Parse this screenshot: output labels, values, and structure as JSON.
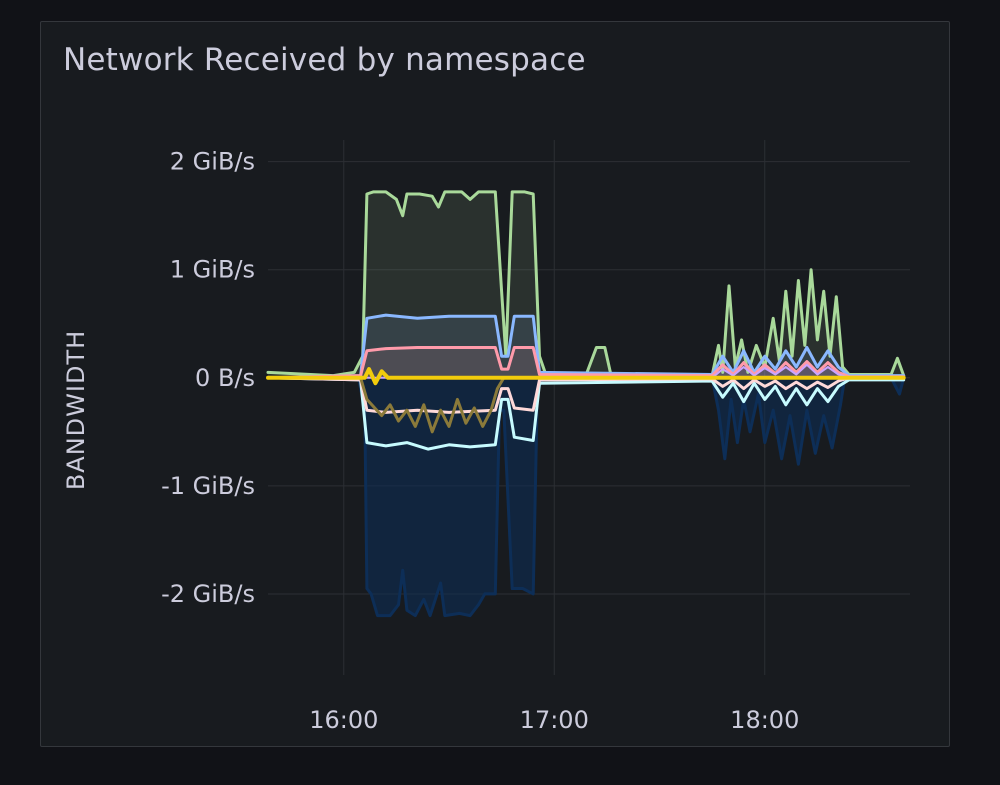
{
  "panel": {
    "title": "Network Received by namespace"
  },
  "chart_data": {
    "type": "line",
    "title": "Network Received by namespace",
    "ylabel": "BANDWIDTH",
    "xlabel": "",
    "x_unit": "hours (clock time)",
    "y_unit": "GiB/s",
    "xlim": [
      15.64,
      18.69
    ],
    "ylim": [
      -2.75,
      2.2
    ],
    "grid": true,
    "legend": "none",
    "x_ticks": [
      {
        "value": 16.0,
        "label": "16:00"
      },
      {
        "value": 17.0,
        "label": "17:00"
      },
      {
        "value": 18.0,
        "label": "18:00"
      }
    ],
    "y_ticks": [
      {
        "value": 2,
        "label": "2 GiB/s"
      },
      {
        "value": 1,
        "label": "1 GiB/s"
      },
      {
        "value": 0,
        "label": "0 B/s"
      },
      {
        "value": -1,
        "label": "-1 GiB/s"
      },
      {
        "value": -2,
        "label": "-2 GiB/s"
      }
    ],
    "series": [
      {
        "color": "#0d2e57",
        "fill": true,
        "stroke_width": 3,
        "points": [
          [
            15.64,
            0
          ],
          [
            16.07,
            0
          ],
          [
            16.1,
            -0.3
          ],
          [
            16.11,
            -1.95
          ],
          [
            16.13,
            -2.0
          ],
          [
            16.16,
            -2.2
          ],
          [
            16.22,
            -2.2
          ],
          [
            16.26,
            -2.1
          ],
          [
            16.28,
            -1.78
          ],
          [
            16.3,
            -2.15
          ],
          [
            16.34,
            -2.2
          ],
          [
            16.38,
            -2.05
          ],
          [
            16.41,
            -2.2
          ],
          [
            16.46,
            -1.9
          ],
          [
            16.48,
            -2.2
          ],
          [
            16.55,
            -2.18
          ],
          [
            16.6,
            -2.2
          ],
          [
            16.64,
            -2.1
          ],
          [
            16.67,
            -2.0
          ],
          [
            16.72,
            -2.0
          ],
          [
            16.74,
            -0.3
          ],
          [
            16.76,
            -0.3
          ],
          [
            16.8,
            -1.95
          ],
          [
            16.85,
            -1.95
          ],
          [
            16.9,
            -2.0
          ],
          [
            16.92,
            -0.1
          ],
          [
            16.95,
            0
          ],
          [
            17.75,
            0
          ],
          [
            17.78,
            -0.3
          ],
          [
            17.81,
            -0.75
          ],
          [
            17.84,
            -0.2
          ],
          [
            17.87,
            -0.6
          ],
          [
            17.9,
            -0.2
          ],
          [
            17.93,
            -0.5
          ],
          [
            17.97,
            -0.15
          ],
          [
            18.0,
            -0.6
          ],
          [
            18.04,
            -0.3
          ],
          [
            18.08,
            -0.75
          ],
          [
            18.12,
            -0.35
          ],
          [
            18.16,
            -0.8
          ],
          [
            18.2,
            -0.3
          ],
          [
            18.24,
            -0.7
          ],
          [
            18.28,
            -0.35
          ],
          [
            18.32,
            -0.65
          ],
          [
            18.36,
            -0.25
          ],
          [
            18.38,
            0
          ],
          [
            18.6,
            0
          ],
          [
            18.64,
            -0.15
          ],
          [
            18.66,
            0
          ]
        ]
      },
      {
        "color": "#a9d99a",
        "fill": true,
        "stroke_width": 3,
        "points": [
          [
            15.64,
            0.05
          ],
          [
            15.95,
            0.02
          ],
          [
            16.05,
            0.05
          ],
          [
            16.09,
            0.2
          ],
          [
            16.11,
            1.7
          ],
          [
            16.14,
            1.72
          ],
          [
            16.2,
            1.72
          ],
          [
            16.25,
            1.65
          ],
          [
            16.28,
            1.5
          ],
          [
            16.3,
            1.7
          ],
          [
            16.36,
            1.7
          ],
          [
            16.42,
            1.68
          ],
          [
            16.45,
            1.58
          ],
          [
            16.48,
            1.72
          ],
          [
            16.56,
            1.72
          ],
          [
            16.6,
            1.65
          ],
          [
            16.64,
            1.72
          ],
          [
            16.72,
            1.72
          ],
          [
            16.75,
            0.8
          ],
          [
            16.77,
            0.2
          ],
          [
            16.8,
            1.72
          ],
          [
            16.86,
            1.72
          ],
          [
            16.9,
            1.7
          ],
          [
            16.93,
            0.2
          ],
          [
            16.96,
            0.03
          ],
          [
            17.15,
            0.02
          ],
          [
            17.2,
            0.28
          ],
          [
            17.24,
            0.28
          ],
          [
            17.27,
            0.02
          ],
          [
            17.75,
            0.02
          ],
          [
            17.78,
            0.3
          ],
          [
            17.8,
            0.05
          ],
          [
            17.83,
            0.85
          ],
          [
            17.86,
            0.1
          ],
          [
            17.89,
            0.35
          ],
          [
            17.92,
            0.05
          ],
          [
            17.96,
            0.3
          ],
          [
            18.0,
            0.1
          ],
          [
            18.04,
            0.55
          ],
          [
            18.07,
            0.15
          ],
          [
            18.1,
            0.8
          ],
          [
            18.13,
            0.2
          ],
          [
            18.16,
            0.9
          ],
          [
            18.19,
            0.3
          ],
          [
            18.22,
            1.0
          ],
          [
            18.25,
            0.35
          ],
          [
            18.28,
            0.8
          ],
          [
            18.31,
            0.2
          ],
          [
            18.34,
            0.75
          ],
          [
            18.37,
            0.1
          ],
          [
            18.4,
            0.03
          ],
          [
            18.6,
            0.03
          ],
          [
            18.63,
            0.18
          ],
          [
            18.66,
            0.02
          ]
        ]
      },
      {
        "color": "#8ab8ff",
        "fill": true,
        "stroke_width": 3,
        "points": [
          [
            15.64,
            0
          ],
          [
            16.08,
            0.02
          ],
          [
            16.11,
            0.55
          ],
          [
            16.2,
            0.58
          ],
          [
            16.35,
            0.55
          ],
          [
            16.5,
            0.57
          ],
          [
            16.72,
            0.57
          ],
          [
            16.75,
            0.2
          ],
          [
            16.78,
            0.2
          ],
          [
            16.81,
            0.57
          ],
          [
            16.9,
            0.57
          ],
          [
            16.93,
            0.05
          ],
          [
            17.75,
            0.03
          ],
          [
            17.8,
            0.2
          ],
          [
            17.85,
            0.05
          ],
          [
            17.9,
            0.25
          ],
          [
            17.95,
            0.05
          ],
          [
            18.0,
            0.2
          ],
          [
            18.05,
            0.08
          ],
          [
            18.1,
            0.25
          ],
          [
            18.15,
            0.1
          ],
          [
            18.2,
            0.28
          ],
          [
            18.25,
            0.1
          ],
          [
            18.3,
            0.25
          ],
          [
            18.35,
            0.1
          ],
          [
            18.4,
            0.02
          ],
          [
            18.66,
            0.02
          ]
        ]
      },
      {
        "color": "#ff9aaa",
        "fill": true,
        "stroke_width": 3,
        "points": [
          [
            15.64,
            0
          ],
          [
            16.08,
            0.02
          ],
          [
            16.11,
            0.25
          ],
          [
            16.2,
            0.27
          ],
          [
            16.35,
            0.28
          ],
          [
            16.5,
            0.28
          ],
          [
            16.72,
            0.28
          ],
          [
            16.75,
            0.08
          ],
          [
            16.78,
            0.08
          ],
          [
            16.81,
            0.28
          ],
          [
            16.9,
            0.28
          ],
          [
            16.93,
            0.03
          ],
          [
            17.75,
            0.02
          ],
          [
            17.8,
            0.12
          ],
          [
            17.85,
            0.03
          ],
          [
            17.9,
            0.14
          ],
          [
            17.95,
            0.03
          ],
          [
            18.0,
            0.12
          ],
          [
            18.05,
            0.04
          ],
          [
            18.1,
            0.14
          ],
          [
            18.15,
            0.05
          ],
          [
            18.2,
            0.15
          ],
          [
            18.25,
            0.05
          ],
          [
            18.3,
            0.14
          ],
          [
            18.35,
            0.05
          ],
          [
            18.4,
            0.01
          ],
          [
            18.66,
            0.01
          ]
        ]
      },
      {
        "color": "#caa4ff",
        "fill": true,
        "stroke_width": 2,
        "points": [
          [
            15.64,
            0
          ],
          [
            17.75,
            0
          ],
          [
            17.8,
            0.08
          ],
          [
            17.85,
            0.02
          ],
          [
            17.9,
            0.1
          ],
          [
            17.95,
            0.02
          ],
          [
            18.0,
            0.09
          ],
          [
            18.05,
            0.03
          ],
          [
            18.1,
            0.1
          ],
          [
            18.15,
            0.03
          ],
          [
            18.2,
            0.12
          ],
          [
            18.25,
            0.03
          ],
          [
            18.3,
            0.1
          ],
          [
            18.35,
            0.03
          ],
          [
            18.4,
            0
          ],
          [
            18.66,
            0
          ]
        ]
      },
      {
        "color": "#c7fbff",
        "fill": false,
        "stroke_width": 3,
        "points": [
          [
            15.64,
            0
          ],
          [
            16.08,
            -0.02
          ],
          [
            16.11,
            -0.6
          ],
          [
            16.2,
            -0.63
          ],
          [
            16.3,
            -0.6
          ],
          [
            16.4,
            -0.66
          ],
          [
            16.5,
            -0.62
          ],
          [
            16.6,
            -0.64
          ],
          [
            16.72,
            -0.62
          ],
          [
            16.75,
            -0.2
          ],
          [
            16.78,
            -0.2
          ],
          [
            16.81,
            -0.55
          ],
          [
            16.9,
            -0.58
          ],
          [
            16.93,
            -0.05
          ],
          [
            17.75,
            -0.03
          ],
          [
            17.8,
            -0.18
          ],
          [
            17.85,
            -0.05
          ],
          [
            17.9,
            -0.22
          ],
          [
            17.95,
            -0.05
          ],
          [
            18.0,
            -0.2
          ],
          [
            18.05,
            -0.08
          ],
          [
            18.1,
            -0.25
          ],
          [
            18.15,
            -0.1
          ],
          [
            18.2,
            -0.25
          ],
          [
            18.25,
            -0.1
          ],
          [
            18.3,
            -0.22
          ],
          [
            18.35,
            -0.08
          ],
          [
            18.4,
            -0.02
          ],
          [
            18.66,
            -0.02
          ]
        ]
      },
      {
        "color": "#ffd9d9",
        "fill": false,
        "stroke_width": 3,
        "points": [
          [
            15.64,
            0
          ],
          [
            16.08,
            -0.02
          ],
          [
            16.11,
            -0.3
          ],
          [
            16.2,
            -0.32
          ],
          [
            16.35,
            -0.3
          ],
          [
            16.5,
            -0.32
          ],
          [
            16.72,
            -0.3
          ],
          [
            16.75,
            -0.1
          ],
          [
            16.78,
            -0.1
          ],
          [
            16.81,
            -0.28
          ],
          [
            16.9,
            -0.3
          ],
          [
            16.93,
            -0.02
          ],
          [
            17.75,
            -0.01
          ],
          [
            17.8,
            -0.08
          ],
          [
            17.85,
            -0.02
          ],
          [
            17.9,
            -0.1
          ],
          [
            17.95,
            -0.02
          ],
          [
            18.0,
            -0.08
          ],
          [
            18.05,
            -0.03
          ],
          [
            18.1,
            -0.1
          ],
          [
            18.15,
            -0.04
          ],
          [
            18.2,
            -0.1
          ],
          [
            18.25,
            -0.04
          ],
          [
            18.3,
            -0.09
          ],
          [
            18.35,
            -0.03
          ],
          [
            18.4,
            0
          ],
          [
            18.66,
            0
          ]
        ]
      },
      {
        "color": "#8b7a3a",
        "fill": false,
        "stroke_width": 3,
        "points": [
          [
            15.64,
            0
          ],
          [
            16.08,
            0
          ],
          [
            16.11,
            -0.2
          ],
          [
            16.18,
            -0.35
          ],
          [
            16.22,
            -0.25
          ],
          [
            16.26,
            -0.4
          ],
          [
            16.3,
            -0.3
          ],
          [
            16.34,
            -0.45
          ],
          [
            16.38,
            -0.25
          ],
          [
            16.42,
            -0.5
          ],
          [
            16.46,
            -0.3
          ],
          [
            16.5,
            -0.45
          ],
          [
            16.54,
            -0.2
          ],
          [
            16.58,
            -0.42
          ],
          [
            16.62,
            -0.28
          ],
          [
            16.66,
            -0.45
          ],
          [
            16.7,
            -0.3
          ],
          [
            16.73,
            -0.1
          ],
          [
            16.76,
            0
          ],
          [
            18.66,
            0
          ]
        ]
      },
      {
        "color": "#f2cc0c",
        "fill": false,
        "stroke_width": 4,
        "points": [
          [
            15.64,
            0
          ],
          [
            16.1,
            0
          ],
          [
            16.12,
            0.08
          ],
          [
            16.15,
            -0.05
          ],
          [
            16.18,
            0.06
          ],
          [
            16.21,
            0
          ],
          [
            18.66,
            0
          ]
        ]
      }
    ]
  }
}
